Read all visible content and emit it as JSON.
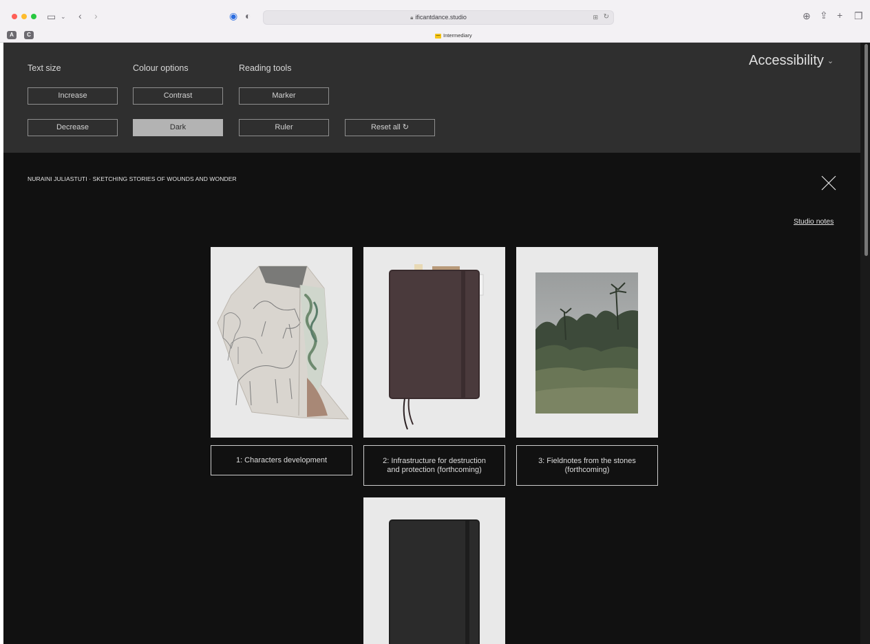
{
  "browser": {
    "url": "ificantdance.studio",
    "tab_title": "Intermediary",
    "tab_chips": [
      "A",
      "C"
    ]
  },
  "accessibility": {
    "title": "Accessibility",
    "groups": [
      {
        "heading": "Text size",
        "buttons": [
          "Increase",
          "Decrease"
        ]
      },
      {
        "heading": "Colour options",
        "buttons": [
          "Contrast",
          "Dark"
        ]
      },
      {
        "heading": "Reading tools",
        "buttons": [
          "Marker",
          "Ruler"
        ]
      }
    ],
    "reset_label": "Reset all ↻",
    "active_option": "Dark"
  },
  "page": {
    "title": "NURAINI JULIASTUTI · SKETCHING STORIES OF WOUNDS AND WONDER",
    "studio_notes": "Studio notes"
  },
  "cards": [
    {
      "label": "1: Characters development",
      "image": "sketchbook-drawings"
    },
    {
      "label": "2: Infrastructure for destruction\nand protection (forthcoming)",
      "image": "brown-notebook"
    },
    {
      "label": "3: Fieldnotes from the stones\n(forthcoming)",
      "image": "jungle-photo"
    },
    {
      "label": "",
      "image": "black-notebook"
    }
  ],
  "colors": {
    "panel_bg": "#2f2f2f",
    "page_bg": "#111111",
    "card_bg": "#e9e9e9"
  }
}
